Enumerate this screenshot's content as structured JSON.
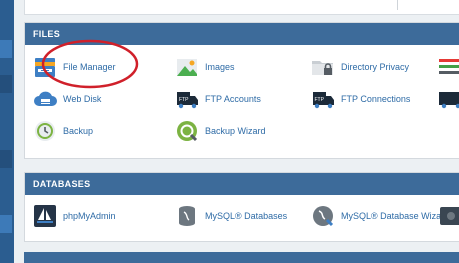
{
  "sections": {
    "files": {
      "title": "FILES",
      "items": [
        "File Manager",
        "Images",
        "Directory Privacy",
        "Web Disk",
        "FTP Accounts",
        "FTP Connections",
        "Backup",
        "Backup Wizard"
      ]
    },
    "databases": {
      "title": "DATABASES",
      "items": [
        "phpMyAdmin",
        "MySQL® Databases",
        "MySQL® Database Wizard"
      ]
    }
  },
  "icons": {
    "file_manager": "file-manager-icon",
    "images": "images-icon",
    "directory_privacy": "folder-lock-icon",
    "web_disk": "cloud-icon",
    "ftp_accounts": "ftp-truck-icon",
    "ftp_connections": "ftp-truck-icon",
    "backup": "backup-clock-icon",
    "backup_wizard": "backup-wizard-icon",
    "phpmyadmin": "sailboat-icon",
    "mysql_databases": "database-icon",
    "mysql_wizard": "database-wizard-icon"
  },
  "colors": {
    "header": "#3d6b9a",
    "link": "#2e6ba6",
    "annotation": "#d0202a"
  }
}
